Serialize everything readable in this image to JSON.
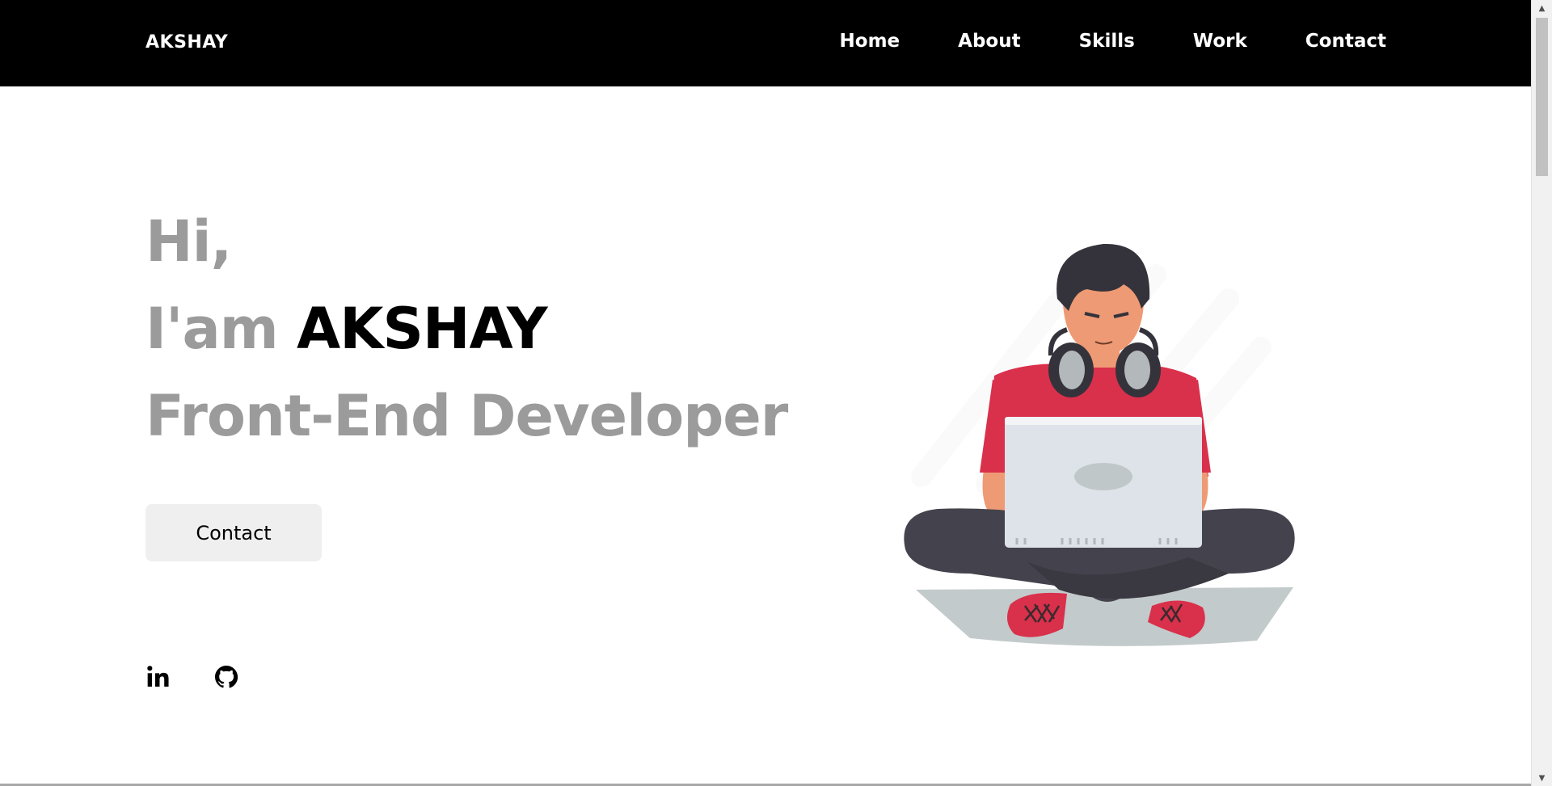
{
  "header": {
    "logo": "AKSHAY",
    "nav": [
      "Home",
      "About",
      "Skills",
      "Work",
      "Contact"
    ]
  },
  "hero": {
    "greeting": "Hi,",
    "intro": "I'am",
    "name": "AKSHAY",
    "role": "Front-End Developer",
    "contact_button": "Contact"
  },
  "social": {
    "icons": [
      "linkedin-icon",
      "github-icon"
    ]
  },
  "colors": {
    "header_bg": "#000000",
    "accent_text": "#9b9b9b",
    "button_bg": "#efefef",
    "shirt_red": "#d9304b"
  }
}
